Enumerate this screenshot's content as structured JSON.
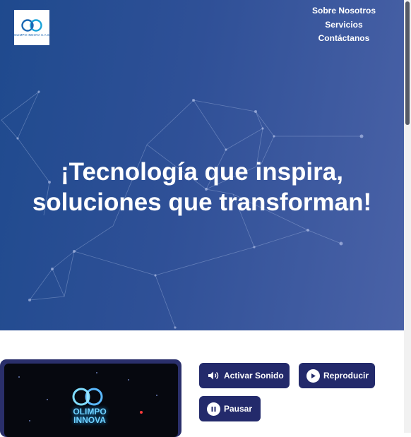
{
  "header": {
    "logo_text": "OLIMPO INNOVA S.A.S",
    "nav": [
      "Sobre Nosotros",
      "Servicios",
      "Contáctanos"
    ]
  },
  "hero": {
    "title_line1": "¡Tecnología que inspira,",
    "title_line2": "soluciones que transforman!"
  },
  "video": {
    "logo_text_line1": "OLIMPO",
    "logo_text_line2": "INNOVA"
  },
  "controls": {
    "sound_label": "Activar Sonido",
    "play_label": "Reproducir",
    "pause_label": "Pausar"
  },
  "colors": {
    "hero_start": "#1f4a8e",
    "hero_end": "#4a62a7",
    "button_bg": "#232a6b",
    "video_frame": "#2a2f6b"
  },
  "icons": {
    "sound": "speaker-icon",
    "play": "play-icon",
    "pause": "pause-icon"
  }
}
